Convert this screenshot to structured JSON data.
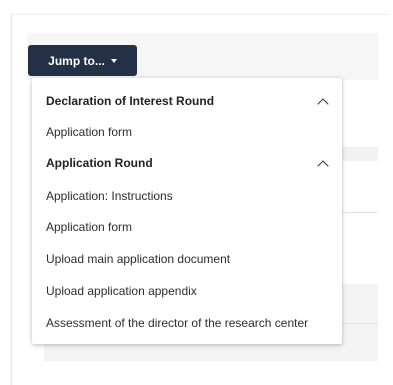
{
  "jump_button": {
    "label": "Jump to..."
  },
  "menu": {
    "sections": [
      {
        "title": "Declaration of Interest Round",
        "expanded": true,
        "items": [
          "Application form"
        ]
      },
      {
        "title": "Application Round",
        "expanded": true,
        "items": [
          "Application: Instructions",
          "Application form",
          "Upload main application document",
          "Upload application appendix",
          "Assessment of the director of the research center"
        ]
      }
    ]
  },
  "colors": {
    "button_bg": "#233045",
    "button_text": "#ffffff",
    "menu_text": "#2d2d2d"
  }
}
